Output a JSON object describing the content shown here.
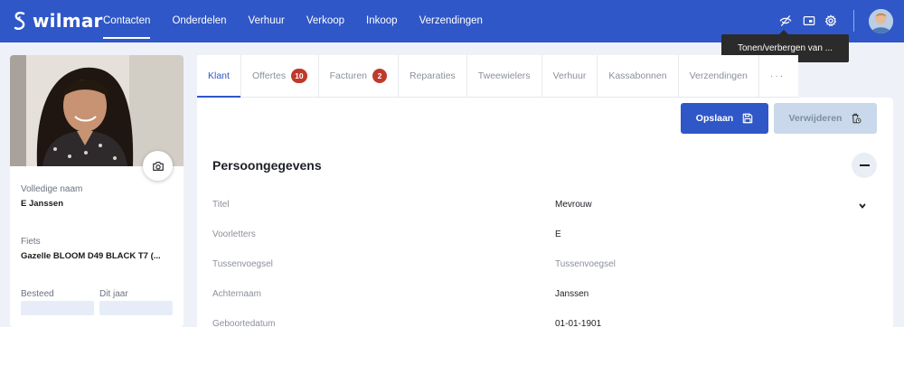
{
  "brand": {
    "name": "wilmar",
    "logo_icon": "wilmar-logo-icon"
  },
  "nav": {
    "items": [
      {
        "label": "Contacten",
        "active": true
      },
      {
        "label": "Onderdelen",
        "active": false
      },
      {
        "label": "Verhuur",
        "active": false
      },
      {
        "label": "Verkoop",
        "active": false
      },
      {
        "label": "Inkoop",
        "active": false
      },
      {
        "label": "Verzendingen",
        "active": false
      }
    ]
  },
  "header_icons": [
    "eye-off-icon",
    "card-window-icon",
    "gear-icon"
  ],
  "tooltip": {
    "text": "Tonen/verbergen van ..."
  },
  "profile": {
    "full_name_label": "Volledige naam",
    "full_name": "E Janssen",
    "bike_label": "Fiets",
    "bike": "Gazelle BLOOM D49 BLACK T7 (...",
    "spent_label": "Besteed",
    "this_year_label": "Dit jaar"
  },
  "tabs": [
    {
      "label": "Klant",
      "badge": "",
      "active": true
    },
    {
      "label": "Offertes",
      "badge": "10",
      "active": false
    },
    {
      "label": "Facturen",
      "badge": "2",
      "active": false
    },
    {
      "label": "Reparaties",
      "badge": "",
      "active": false
    },
    {
      "label": "Tweewielers",
      "badge": "",
      "active": false
    },
    {
      "label": "Verhuur",
      "badge": "",
      "active": false
    },
    {
      "label": "Kassabonnen",
      "badge": "",
      "active": false
    },
    {
      "label": "Verzendingen",
      "badge": "",
      "active": false
    },
    {
      "label": "···",
      "badge": "",
      "active": false
    }
  ],
  "actions": {
    "save_label": "Opslaan",
    "delete_label": "Verwijderen"
  },
  "section": {
    "title": "Persoongegevens"
  },
  "fields": [
    {
      "label": "Titel",
      "value": "Mevrouw"
    },
    {
      "label": "Voorletters",
      "value": "E"
    },
    {
      "label": "Tussenvoegsel",
      "placeholder": "Tussenvoegsel"
    },
    {
      "label": "Achternaam",
      "value": "Janssen"
    },
    {
      "label": "Geboortedatum",
      "value": "01-01-1901"
    }
  ],
  "colors": {
    "primary": "#2f57c7",
    "badge": "#c0392b",
    "disabled_button": "#c9d8ea",
    "page_background": "#eef1f8"
  }
}
